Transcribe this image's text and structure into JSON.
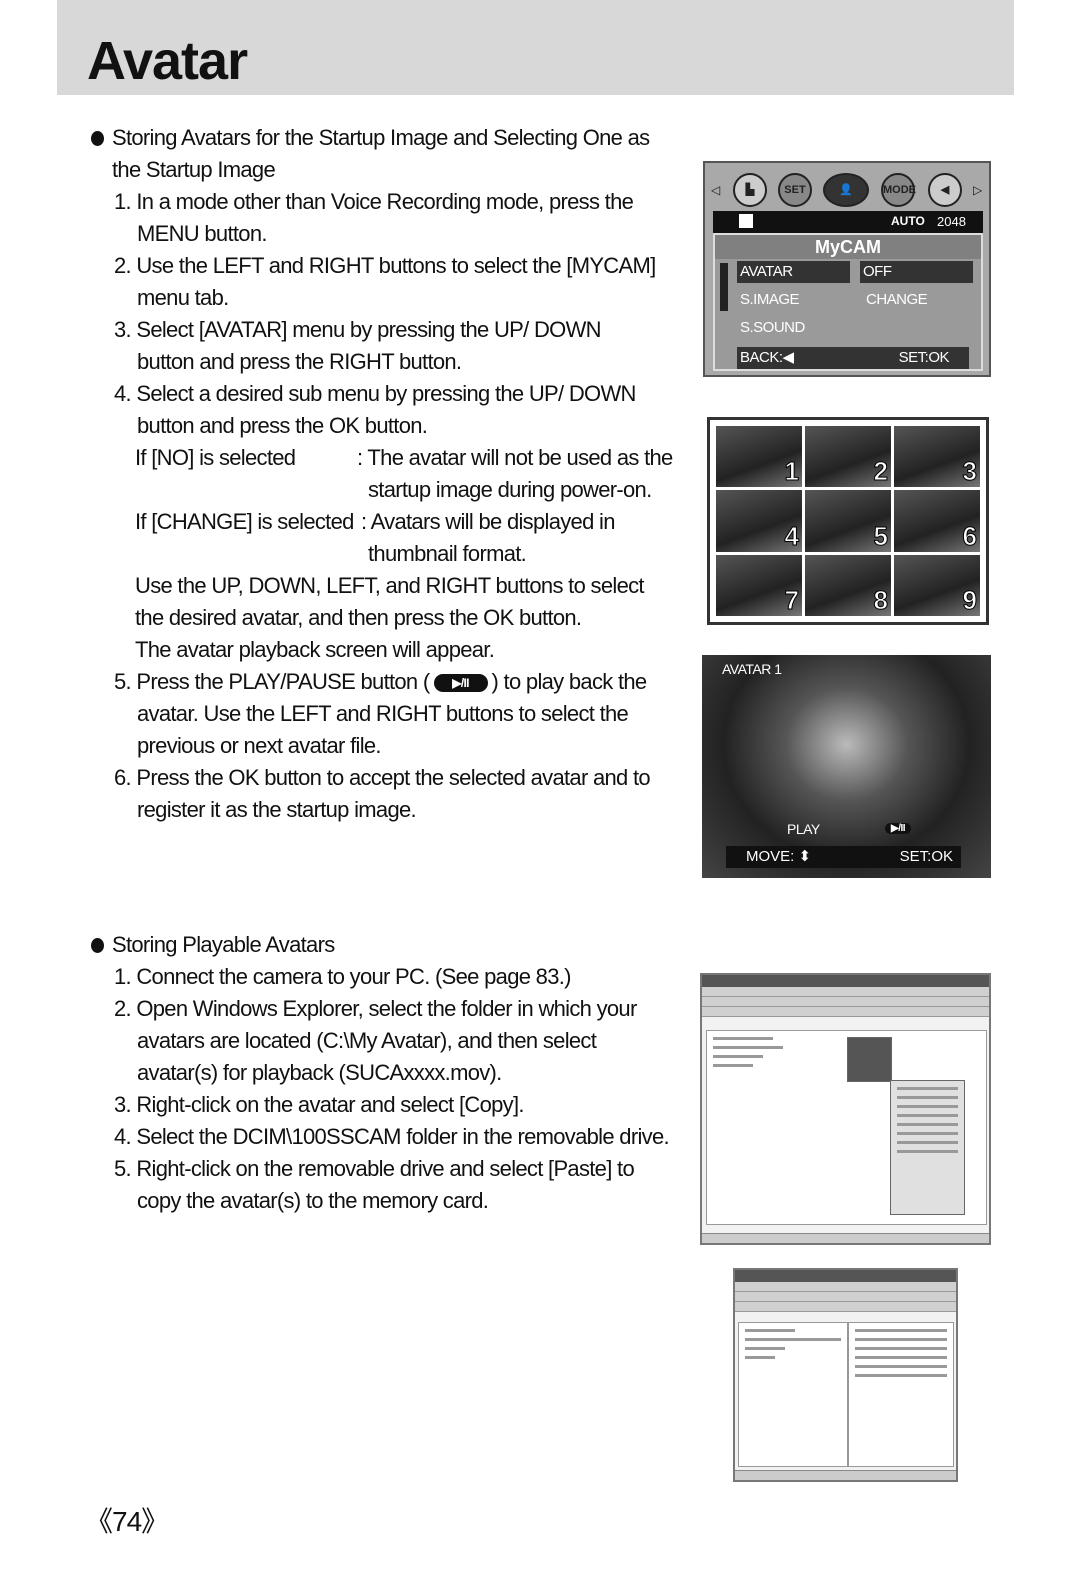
{
  "header": {
    "title": "Avatar"
  },
  "section1": {
    "heading": [
      "Storing Avatars for the Startup Image and Selecting One as",
      "the Startup Image"
    ],
    "lines": [
      "1. In a mode other than Voice Recording mode, press the",
      "MENU button.",
      "2. Use the LEFT and RIGHT buttons to select the [MYCAM]",
      "menu tab.",
      "3. Select [AVATAR] menu by pressing the UP/ DOWN",
      "button and press the RIGHT button.",
      "4. Select a desired sub menu by pressing the UP/ DOWN",
      "button and press the OK button."
    ],
    "options": [
      {
        "label": "If [NO] is selected",
        "desc": [
          ": The avatar will not be used as the",
          "startup image during power-on."
        ]
      },
      {
        "label": "If [CHANGE] is selected",
        "desc": [
          ": Avatars will be displayed in",
          "thumbnail format."
        ]
      }
    ],
    "after": [
      "Use the UP, DOWN, LEFT, and RIGHT buttons to select",
      "the desired avatar, and then press the OK button.",
      "The avatar playback screen will appear."
    ],
    "step5_a": "5. Press the PLAY/PAUSE button (",
    "step5_icon": "▶/II",
    "step5_b": ") to play back the",
    "step5_lines": [
      "avatar. Use the LEFT and RIGHT buttons to select the",
      "previous or next avatar file."
    ],
    "step6": [
      "6. Press the OK button to accept the selected avatar and to",
      "register it as the startup image."
    ]
  },
  "camera_menu": {
    "icons": [
      "image-size-icon",
      "SET",
      "mycam-icon",
      "MODE",
      "sound-icon"
    ],
    "status": {
      "auto": "AUTO",
      "size": "2048"
    },
    "title": "MyCAM",
    "items": [
      {
        "label": "AVATAR",
        "value": "OFF"
      },
      {
        "label": "S.IMAGE",
        "value": "CHANGE"
      },
      {
        "label": "S.SOUND",
        "value": ""
      }
    ],
    "back": "BACK:◀",
    "set": "SET:OK"
  },
  "thumbnails": [
    "1",
    "2",
    "3",
    "4",
    "5",
    "6",
    "7",
    "8",
    "9"
  ],
  "playback": {
    "title": "AVATAR 1",
    "play": "PLAY",
    "icon": "▶/II",
    "move": "MOVE: ⬍",
    "set": "SET:OK"
  },
  "section2": {
    "heading": "Storing Playable Avatars",
    "lines": [
      "1. Connect the camera to your PC. (See page 83.)",
      "2. Open Windows Explorer, select the folder in which your",
      "avatars are located (C:\\My Avatar), and then select",
      "avatar(s) for playback (SUCAxxxx.mov).",
      "3. Right-click on the avatar and select [Copy].",
      "4. Select the DCIM\\100SSCAM folder in the removable drive.",
      "5. Right-click on the removable drive and select [Paste] to",
      "copy the avatar(s) to the memory card."
    ]
  },
  "page_number": "《74》"
}
